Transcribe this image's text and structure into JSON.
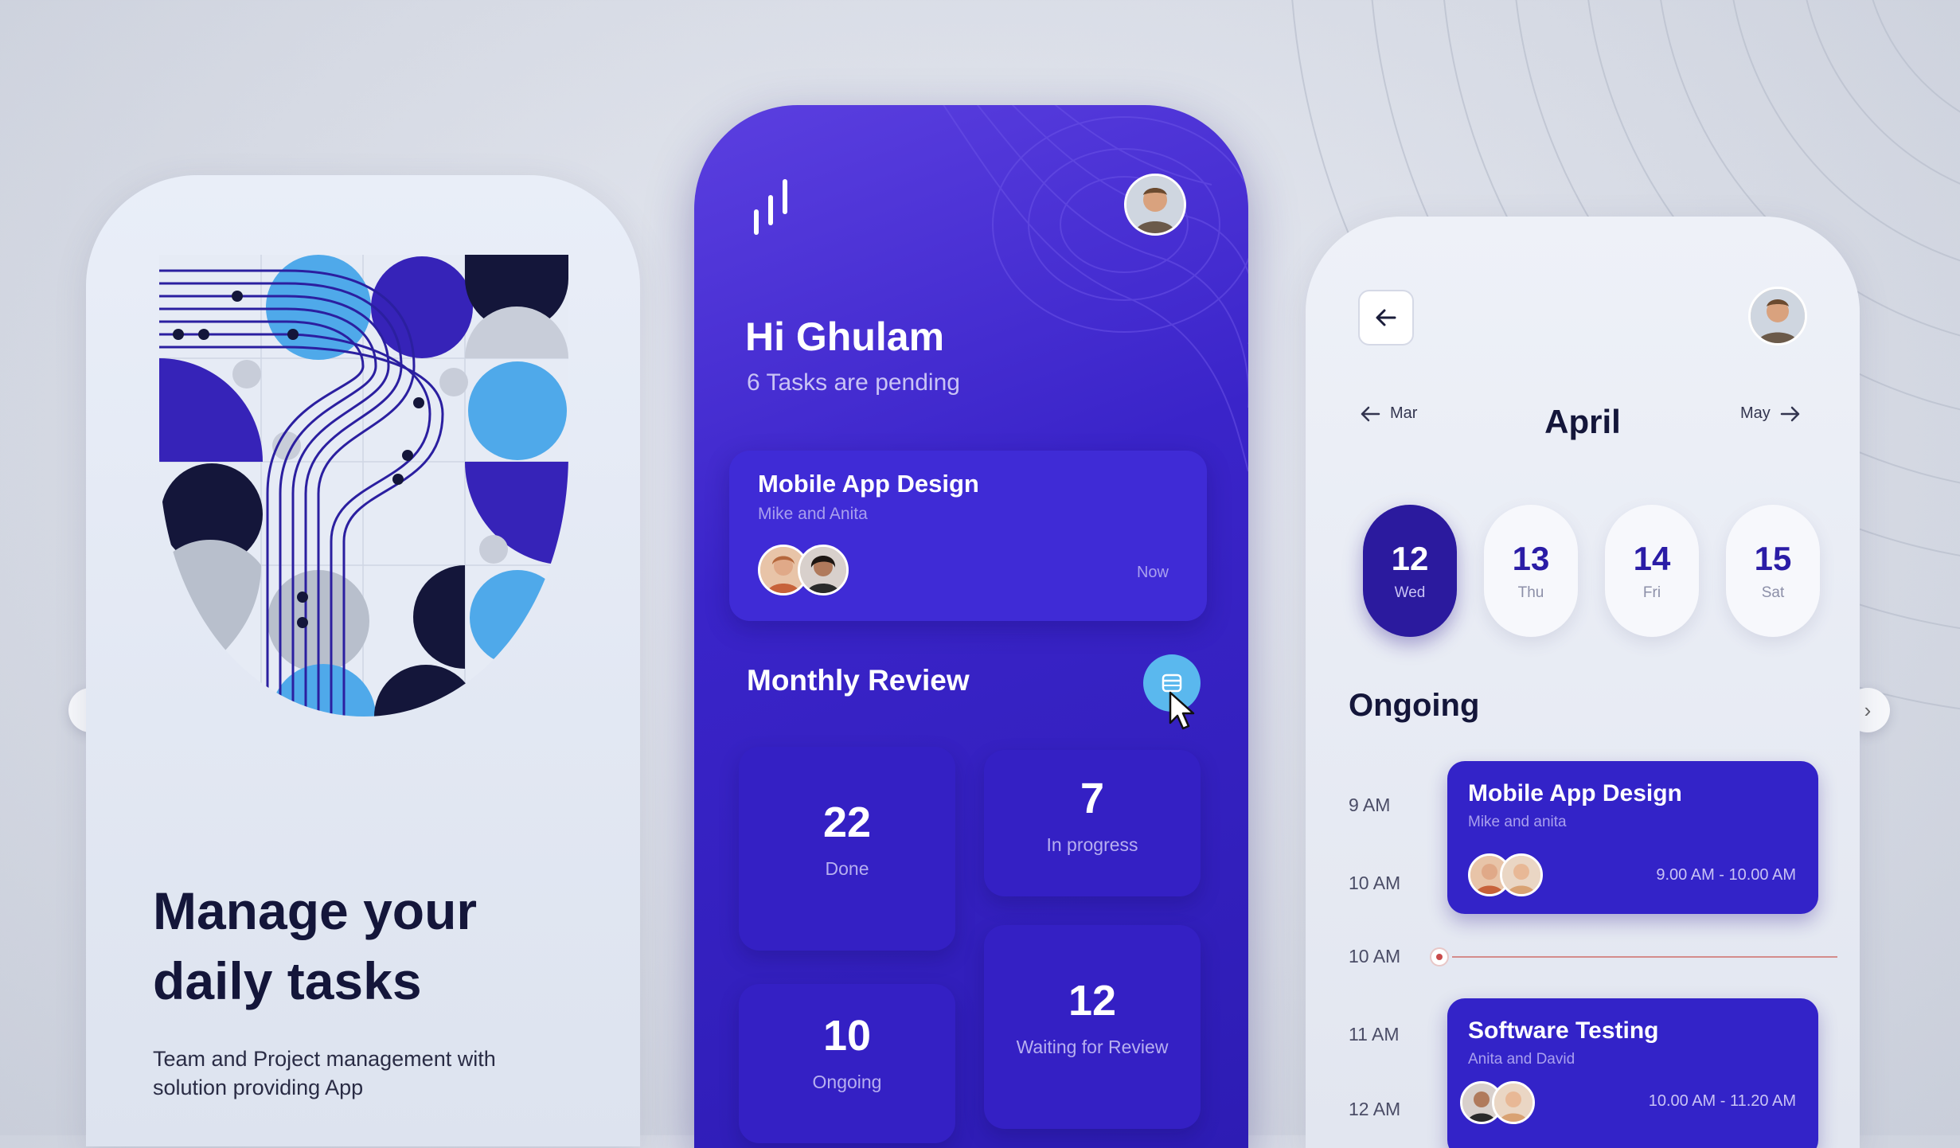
{
  "left_phone": {
    "headline": "Manage your daily tasks",
    "subtext": "Team and Project management with solution providing App"
  },
  "mid_phone": {
    "greeting": "Hi Ghulam",
    "pending": "6 Tasks are pending",
    "task": {
      "title": "Mobile App Design",
      "members": "Mike and Anita",
      "time": "Now"
    },
    "review_title": "Monthly Review",
    "stats": [
      {
        "value": "22",
        "label": "Done"
      },
      {
        "value": "7",
        "label": "In progress"
      },
      {
        "value": "10",
        "label": "Ongoing"
      },
      {
        "value": "12",
        "label": "Waiting for Review"
      }
    ]
  },
  "right_phone": {
    "prev_month": "Mar",
    "month": "April",
    "next_month": "May",
    "days": [
      {
        "num": "12",
        "label": "Wed",
        "active": true
      },
      {
        "num": "13",
        "label": "Thu",
        "active": false
      },
      {
        "num": "14",
        "label": "Fri",
        "active": false
      },
      {
        "num": "15",
        "label": "Sat",
        "active": false
      }
    ],
    "section_title": "Ongoing",
    "times": [
      "9 AM",
      "10 AM",
      "10 AM",
      "11 AM",
      "12 AM"
    ],
    "events": [
      {
        "title": "Mobile App Design",
        "members": "Mike and anita",
        "range": "9.00 AM - 10.00 AM"
      },
      {
        "title": "Software Testing",
        "members": "Anita and David",
        "range": "10.00 AM - 11.20 AM"
      }
    ]
  },
  "icons": {
    "prev_slide": "chevron-left-icon",
    "next_slide": "chevron-right-icon",
    "back": "arrow-left-icon"
  },
  "colors": {
    "primary": "#3a24c9",
    "accent": "#5ab8ee",
    "dark": "#14163a"
  }
}
